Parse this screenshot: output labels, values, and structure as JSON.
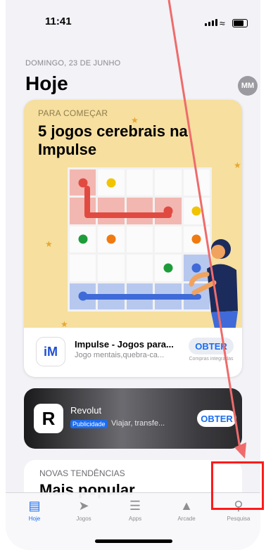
{
  "status": {
    "time": "11:41"
  },
  "header": {
    "date": "DOMINGO, 23 DE JUNHO",
    "title": "Hoje",
    "avatar": "MM"
  },
  "feature": {
    "eyebrow": "PARA COMEÇAR",
    "headline": "5 jogos cerebrais na Impulse",
    "app": {
      "name": "Impulse - Jogos para...",
      "subtitle": "Jogo mentais,quebra-ca...",
      "get": "OBTER",
      "inapp": "Compras integradas"
    }
  },
  "ad": {
    "name": "Revolut",
    "badge": "Publicidade",
    "subtitle": "Viajar, transfe...",
    "get": "OBTER"
  },
  "trending": {
    "eyebrow": "NOVAS TENDÊNCIAS",
    "title": "Mais popular"
  },
  "tabs": [
    {
      "label": "Hoje",
      "icon": "today-icon"
    },
    {
      "label": "Jogos",
      "icon": "rocket-icon"
    },
    {
      "label": "Apps",
      "icon": "layers-icon"
    },
    {
      "label": "Arcade",
      "icon": "joystick-icon"
    },
    {
      "label": "Pesquisa",
      "icon": "search-icon"
    }
  ],
  "colors": {
    "accent": "#1b6cf2",
    "highlight": "#ff1a1a",
    "card": "#f6df9f"
  }
}
